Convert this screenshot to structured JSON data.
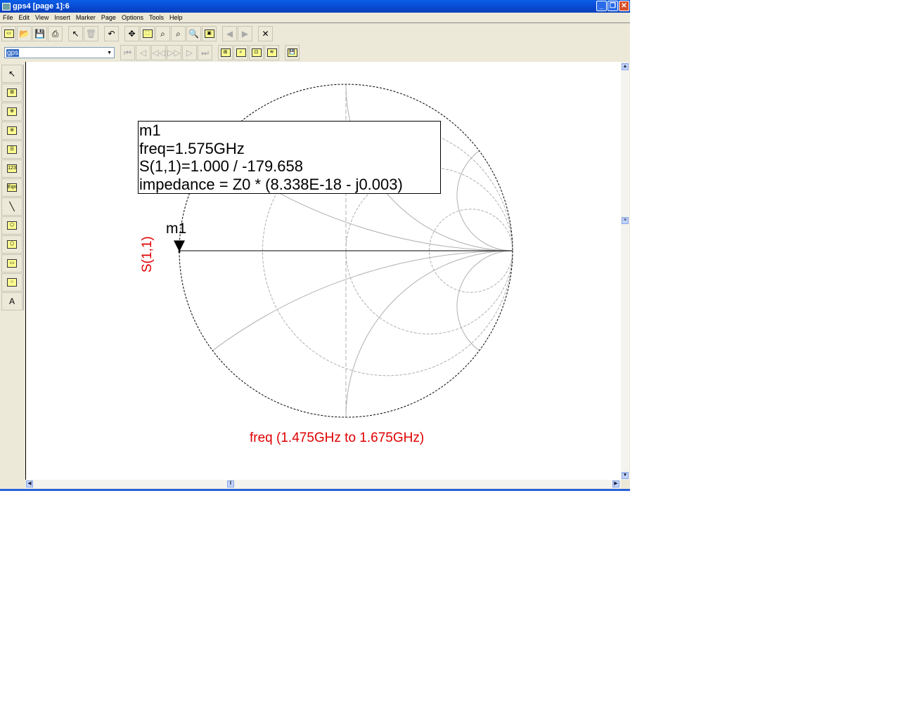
{
  "window": {
    "title": "gps4 [page 1]:6",
    "controls": [
      "minimize",
      "restore",
      "close"
    ]
  },
  "menu": [
    "File",
    "Edit",
    "View",
    "Insert",
    "Marker",
    "Page",
    "Options",
    "Tools",
    "Help"
  ],
  "toolbar1": [
    {
      "name": "new-icon",
      "glyph": "▭"
    },
    {
      "name": "open-icon",
      "glyph": "📂"
    },
    {
      "name": "save-icon",
      "glyph": "💾"
    },
    {
      "name": "print-icon",
      "glyph": "⎙"
    },
    {
      "name": "select-arrow-icon",
      "glyph": "↖"
    },
    {
      "name": "delete-icon",
      "glyph": "🗑",
      "disabled": true
    },
    {
      "name": "undo-icon",
      "glyph": "↶"
    },
    {
      "name": "pan-icon",
      "glyph": "✥"
    },
    {
      "name": "zoom-area-icon",
      "glyph": "⬚"
    },
    {
      "name": "zoom-in-icon",
      "glyph": "⌕"
    },
    {
      "name": "zoom-out-icon",
      "glyph": "⌕"
    },
    {
      "name": "zoom-fit-icon",
      "glyph": "🔍"
    },
    {
      "name": "view-all-icon",
      "glyph": "▣"
    },
    {
      "name": "prev-icon",
      "glyph": "◀",
      "disabled": true
    },
    {
      "name": "next-icon",
      "glyph": "▶",
      "disabled": true
    },
    {
      "name": "stop-icon",
      "glyph": "✕"
    }
  ],
  "page_combo": {
    "value": "gps"
  },
  "toolbar2": [
    {
      "name": "first-page-icon",
      "glyph": "⏮",
      "disabled": true
    },
    {
      "name": "prev-page-icon",
      "glyph": "◁",
      "disabled": true
    },
    {
      "name": "rewind-icon",
      "glyph": "◁◁",
      "disabled": true
    },
    {
      "name": "forward-icon",
      "glyph": "▷▷",
      "disabled": true
    },
    {
      "name": "next-page-icon",
      "glyph": "▷",
      "disabled": true
    },
    {
      "name": "last-page-icon",
      "glyph": "⏭",
      "disabled": true
    },
    {
      "name": "plot-options-icon",
      "glyph": "⊞"
    },
    {
      "name": "zoom-plot-icon",
      "glyph": "⌕"
    },
    {
      "name": "trace-icon",
      "glyph": "⊡"
    },
    {
      "name": "marker-options-icon",
      "glyph": "≋"
    },
    {
      "name": "export-icon",
      "glyph": "💾"
    }
  ],
  "left_tools": [
    {
      "name": "pointer-tool-icon",
      "glyph": "↖"
    },
    {
      "name": "rectangular-plot-icon",
      "glyph": "⊞"
    },
    {
      "name": "smith-chart-icon",
      "glyph": "⊕"
    },
    {
      "name": "polar-plot-icon",
      "glyph": "⊛"
    },
    {
      "name": "stacked-plot-icon",
      "glyph": "☰"
    },
    {
      "name": "list-icon",
      "glyph": "123"
    },
    {
      "name": "equation-icon",
      "glyph": "Eqn"
    },
    {
      "name": "line-tool-icon",
      "glyph": "╲"
    },
    {
      "name": "polyline-icon",
      "glyph": "⬠"
    },
    {
      "name": "polygon-icon",
      "glyph": "⬠"
    },
    {
      "name": "rectangle-tool-icon",
      "glyph": "▭"
    },
    {
      "name": "ellipse-tool-icon",
      "glyph": "○"
    },
    {
      "name": "text-tool-icon",
      "glyph": "A"
    }
  ],
  "marker": {
    "name": "m1",
    "lines": [
      "m1",
      "freq=1.575GHz",
      "S(1,1)=1.000 / -179.658",
      "impedance = Z0 * (8.338E-18 - j0.003)"
    ]
  },
  "chart_data": {
    "type": "smith",
    "trace_label": "S(1,1)",
    "sweep_label": "freq (1.475GHz to 1.675GHz)",
    "resistance_circles": [
      0.333,
      1,
      3
    ],
    "reactance_arcs": [
      0.333,
      1,
      3
    ],
    "marker": {
      "name": "m1",
      "freq_GHz": 1.575,
      "mag": 1.0,
      "angle_deg": -179.658
    },
    "colors": {
      "trace_label": "#e00000",
      "grid": "#b0b0b0",
      "outline": "#000000"
    }
  }
}
